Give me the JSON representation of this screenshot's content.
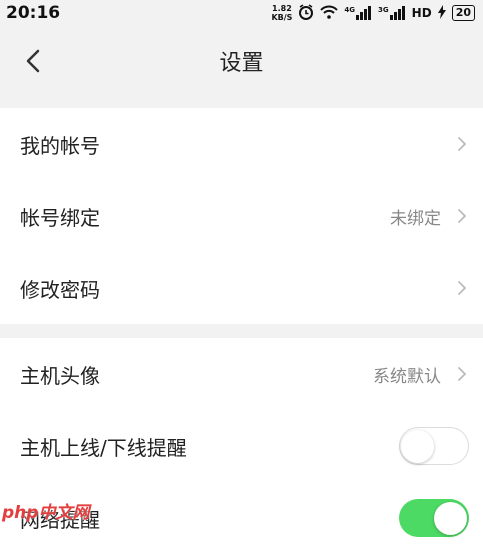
{
  "status_bar": {
    "time": "20:16",
    "speed_value": "1.82",
    "speed_unit": "KB/S",
    "sig1_label": "4G",
    "sig2_label": "3G",
    "hd_label": "HD",
    "battery": "20"
  },
  "header": {
    "title": "设置",
    "back_icon": "chevron-left-icon"
  },
  "groups": [
    {
      "rows": [
        {
          "label": "我的帐号",
          "value": ""
        },
        {
          "label": "帐号绑定",
          "value": "未绑定"
        },
        {
          "label": "修改密码",
          "value": ""
        }
      ]
    },
    {
      "rows": [
        {
          "label": "主机头像",
          "value": "系统默认"
        },
        {
          "label": "主机上线/下线提醒",
          "toggle": false
        },
        {
          "label": "网络提醒",
          "toggle": true
        }
      ]
    }
  ],
  "watermark": "php中文网",
  "colors": {
    "background": "#f2f2f2",
    "toggle_on": "#4cd964",
    "toggle_off_border": "#dcdcdc",
    "secondary_text": "#888888"
  }
}
